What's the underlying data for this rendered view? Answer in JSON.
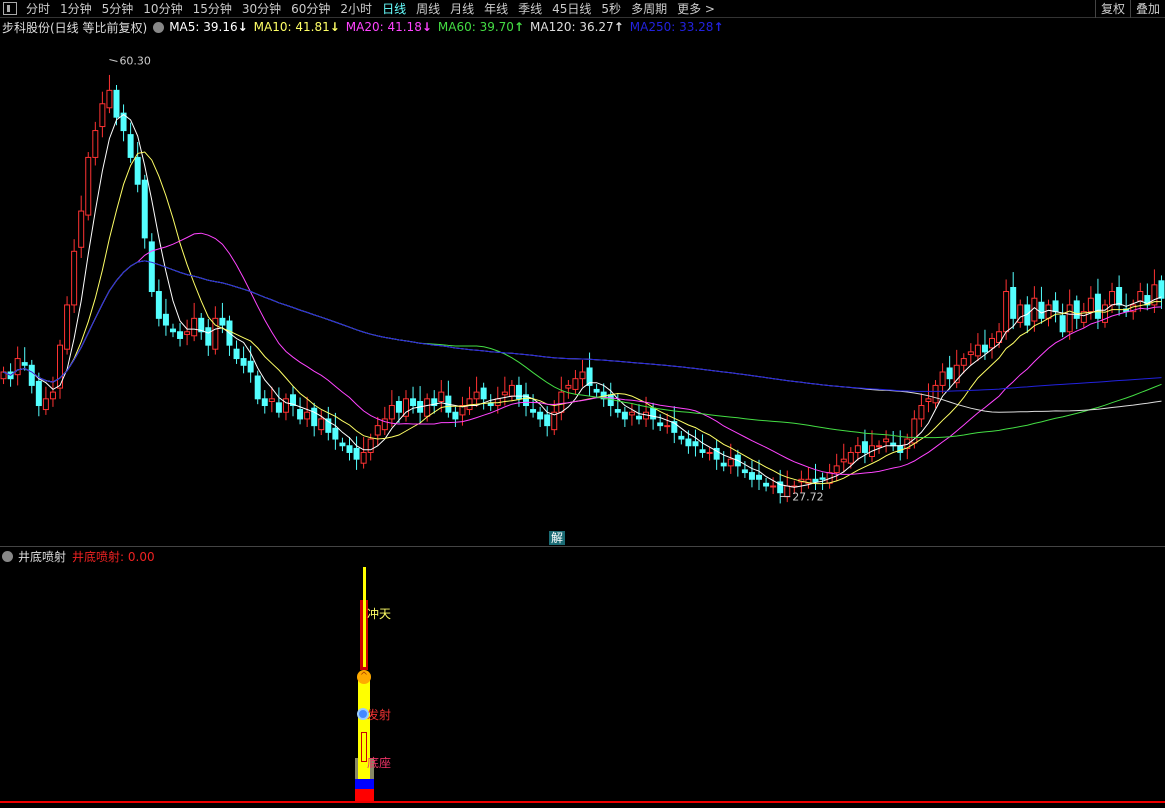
{
  "toolbar": {
    "periods": [
      "分时",
      "1分钟",
      "5分钟",
      "10分钟",
      "15分钟",
      "30分钟",
      "60分钟",
      "2小时",
      "日线",
      "周线",
      "月线",
      "年线",
      "季线",
      "45日线",
      "5秒",
      "多周期",
      "更多 >"
    ],
    "active": "日线",
    "right": [
      "复权",
      "叠加"
    ]
  },
  "legend": {
    "title": "步科股份(日线 等比前复权)",
    "ma": [
      {
        "label": "MA5: 39.16",
        "arrow": "↓",
        "color": "#ffffff"
      },
      {
        "label": "MA10: 41.81",
        "arrow": "↓",
        "color": "#ffff66"
      },
      {
        "label": "MA20: 41.18",
        "arrow": "↓",
        "color": "#ff44ff"
      },
      {
        "label": "MA60: 39.70",
        "arrow": "↑",
        "color": "#44dd44"
      },
      {
        "label": "MA120: 36.27",
        "arrow": "↑",
        "color": "#dddddd"
      },
      {
        "label": "MA250: 33.28",
        "arrow": "↑",
        "color": "#2222dd"
      }
    ]
  },
  "annotations": {
    "high": "60.30",
    "low": "27.72"
  },
  "jie_button": "解",
  "indicator": {
    "name": "井底喷射",
    "value_label": "井底喷射: 0.00",
    "labels": [
      "冲天",
      "发射",
      "底座"
    ]
  },
  "colors": {
    "up": "#ff3333",
    "down": "#54ffff"
  },
  "chart_data": {
    "type": "candlestick",
    "ylim": [
      24.1,
      62.5
    ],
    "high_value": 60.3,
    "low_value": 27.72,
    "close": [
      37,
      36.5,
      38,
      37.5,
      36,
      34.5,
      35,
      35.5,
      39,
      42,
      46,
      49,
      53,
      55,
      57,
      58,
      56,
      55,
      53,
      51,
      47,
      43,
      41,
      40.5,
      40,
      39.5,
      40,
      41,
      40,
      39,
      41,
      40.5,
      39,
      38,
      37.5,
      37,
      35,
      34.5,
      35,
      34,
      35,
      34.5,
      33.5,
      34,
      33,
      33.5,
      32.5,
      32,
      31.5,
      31,
      30.5,
      31,
      32,
      33,
      33.5,
      34.5,
      34,
      35,
      34.5,
      34,
      35,
      34.5,
      35.5,
      34,
      33.5,
      34.5,
      35,
      35.5,
      35,
      34.5,
      35,
      35.5,
      36,
      35,
      34.5,
      34,
      33.5,
      33,
      34,
      35.5,
      36,
      36.5,
      37,
      36,
      35.5,
      35,
      34.5,
      34,
      33.5,
      34,
      33.5,
      34,
      33.5,
      33,
      33,
      32.5,
      32,
      31.5,
      31.5,
      31,
      31,
      30.5,
      30,
      30.5,
      30,
      29.5,
      29,
      29,
      28.5,
      28.5,
      28,
      28.5,
      28.5,
      29,
      29,
      28.8,
      29,
      29.5,
      30,
      30.5,
      31,
      31.5,
      31,
      31.5,
      31.5,
      32,
      31.5,
      31,
      32,
      33.5,
      34.5,
      35,
      36,
      37,
      36.5,
      37.5,
      38,
      38.5,
      39,
      38.5,
      39.5,
      40,
      43,
      41,
      42,
      40.5,
      42.5,
      41,
      42,
      41.5,
      40,
      42,
      41,
      41.5,
      42.5,
      41,
      42,
      43,
      42,
      41.5,
      42,
      43,
      42,
      43.5,
      42.5
    ],
    "ma_periods": [
      5,
      10,
      20,
      60,
      120,
      250
    ]
  }
}
